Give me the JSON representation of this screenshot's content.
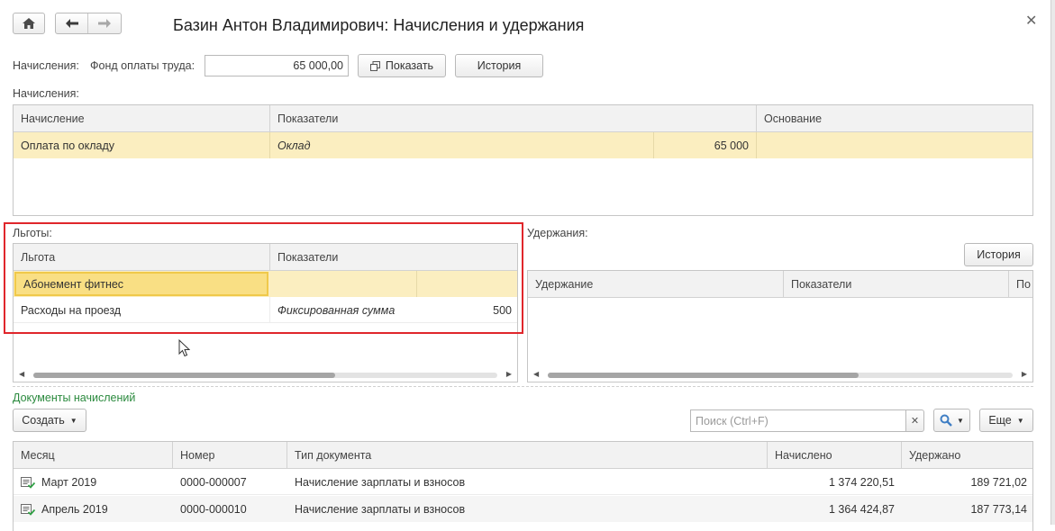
{
  "window": {
    "title": "Базин Антон Владимирович: Начисления и удержания"
  },
  "topbar": {
    "accruals_label": "Начисления:",
    "fund_label": "Фонд оплаты труда:",
    "fund_value": "65 000,00",
    "show_button": "Показать",
    "history_button": "История"
  },
  "accruals": {
    "section_label": "Начисления:",
    "headers": [
      "Начисление",
      "Показатели",
      "Основание"
    ],
    "rows": [
      {
        "name": "Оплата по окладу",
        "indicator": "Оклад",
        "value": "65 000",
        "basis": ""
      }
    ]
  },
  "benefits": {
    "section_label": "Льготы:",
    "headers": [
      "Льгота",
      "Показатели"
    ],
    "rows": [
      {
        "name": "Абонемент фитнес",
        "indicator": "",
        "value": ""
      },
      {
        "name": "Расходы на проезд",
        "indicator": "Фиксированная сумма",
        "value": "500"
      }
    ]
  },
  "deductions": {
    "section_label": "Удержания:",
    "history_button": "История",
    "headers": [
      "Удержание",
      "Показатели",
      "По"
    ]
  },
  "documents": {
    "link": "Документы начислений",
    "create_button": "Создать",
    "search_placeholder": "Поиск (Ctrl+F)",
    "more_button": "Еще",
    "headers": [
      "Месяц",
      "Номер",
      "Тип документа",
      "Начислено",
      "Удержано"
    ],
    "rows": [
      {
        "month": "Март 2019",
        "number": "0000-000007",
        "type": "Начисление зарплаты и взносов",
        "accrued": "1 374 220,51",
        "withheld": "189 721,02"
      },
      {
        "month": "Апрель 2019",
        "number": "0000-000010",
        "type": "Начисление зарплаты и взносов",
        "accrued": "1 364 424,87",
        "withheld": "187 773,14"
      }
    ]
  },
  "icons": {
    "home": "home-icon",
    "back": "arrow-left-icon",
    "forward": "arrow-right-icon",
    "close": "close-icon",
    "show": "open-window-icon",
    "search": "magnifier-icon",
    "doc": "posted-document-icon"
  },
  "colors": {
    "selection": "#fbeec0",
    "selection_active": "#f9df84",
    "highlight_frame": "#e0262b",
    "link_green": "#2b8a3e",
    "search_blue": "#3f7ec4"
  }
}
